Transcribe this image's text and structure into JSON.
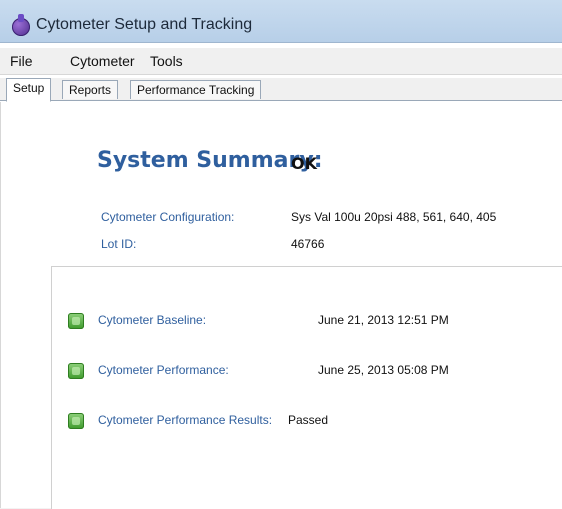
{
  "window": {
    "title": "Cytometer Setup and Tracking",
    "icon": "cytometer-app-icon"
  },
  "menubar": {
    "items": [
      {
        "label": "File"
      },
      {
        "label": "Cytometer"
      },
      {
        "label": "Tools"
      }
    ]
  },
  "tabs": [
    {
      "label": "Setup",
      "active": true
    },
    {
      "label": "Reports",
      "active": false
    },
    {
      "label": "Performance Tracking",
      "active": false
    }
  ],
  "setup": {
    "summary_label": "System Summary:",
    "summary_value": "OK",
    "cytometer_configuration_label": "Cytometer Configuration:",
    "cytometer_configuration_value": "Sys Val 100u 20psi 488, 561, 640, 405",
    "lot_id_label": "Lot ID:",
    "lot_id_value": "46766"
  },
  "status_rows": [
    {
      "label": "Cytometer Baseline:",
      "value": "June 21, 2013 12:51 PM",
      "status": "ok",
      "icon": "green-status-icon"
    },
    {
      "label": "Cytometer Performance:",
      "value": "June 25, 2013 05:08 PM",
      "status": "ok",
      "icon": "green-status-icon"
    },
    {
      "label": "Cytometer Performance Results:",
      "value": "Passed",
      "status": "ok",
      "icon": "green-status-icon"
    }
  ],
  "colors": {
    "label_blue": "#2f5f9e",
    "status_green": "#3d9a2b"
  }
}
